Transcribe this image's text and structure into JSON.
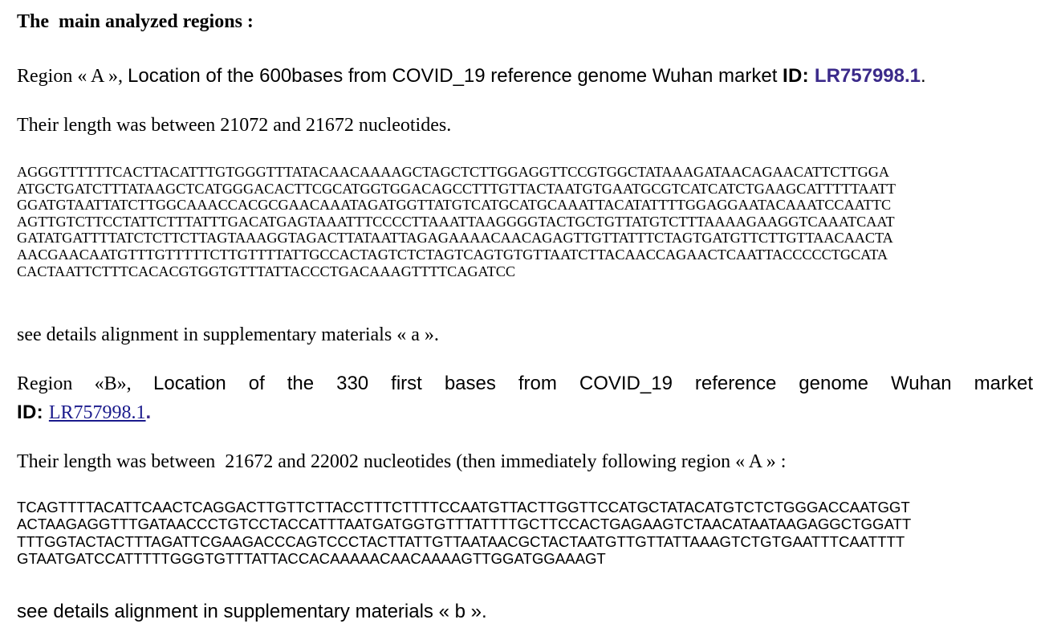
{
  "heading": "The  main analyzed regions :",
  "regionA": {
    "title_prefix": "Region « A », ",
    "title_main": "Location of the 600bases from COVID_19 reference genome Wuhan market ",
    "id_label": "ID: ",
    "id_value": "LR757998.1",
    "title_end": ".",
    "length_text": "Their length was between 21072 and 21672 nucleotides.",
    "sequence_lines": [
      "AGGGTTTTTTCACTTACATTTGTGGGTTTATACAACAAAAGCTAGCTCTTGGAGGTTCCGTGGCTATAAAGATAACAGAACATTCTTGGA",
      "ATGCTGATCTTTATAAGCTCATGGGACACTTCGCATGGTGGACAGCCTTTGTTACTAATGTGAATGCGTCATCATCTGAAGCATTTTTAATT",
      "GGATGTAATTATCTTGGCAAACCACGCGAACAAATAGATGGTTATGTCATGCATGCAAATTACATATTTTGGAGGAATACAAATCCAATTC",
      "AGTTGTCTTCCTATTCTTTATTTGACATGAGTAAATTTCCCCTTAAATTAAGGGGTACTGCTGTTATGTCTTTAAAAGAAGGTCAAATCAAT",
      "GATATGATTTTATCTCTTCTTAGTAAAGGTAGACTTATAATTAGAGAAAACAACAGAGTTGTTATTTCTAGTGATGTTCTTGTTAACAACTA",
      "AACGAACAATGTTTGTTTTTCTTGTTTTATTGCCACTAGTCTCTAGTCAGTGTGTTAATCTTACAACCAGAACTCAATTACCCCCTGCATA",
      "CACTAATTCTTTCACACGTGGTGTTTATTACCCTGACAAAGTTTTCAGATCC"
    ],
    "details_text": "see details alignment in supplementary materials « a »."
  },
  "regionB": {
    "title_prefix": "Region «B», ",
    "title_main_line1": "Location of the 330 first bases from COVID_19 reference genome Wuhan market",
    "id_label": "ID: ",
    "id_value": "LR757998.1",
    "title_end": ".",
    "length_text": "Their length was between  21672 and 22002 nucleotides (then immediately following region « A » :",
    "sequence_lines": [
      "TCAGTTTTACATTCAACTCAGGACTTGTTCTTACCTTTCTTTTCCAATGTTACTTGGTTCCATGCTATACATGTCTCTGGGACCAATGGT",
      "ACTAAGAGGTTTGATAACCCTGTCCTACCATTTAATGATGGTGTTTATTTTGCTTCCACTGAGAAGTCTAACATAATAAGAGGCTGGATT",
      "TTTGGTACTACTTTAGATTCGAAGACCCAGTCCCTACTTATTGTTAATAACGCTACTAATGTTGTTATTAAAGTCTGTGAATTTCAATTTT",
      "GTAATGATCCATTTTTGGGTGTTTATTACCACAAAAACAACAAAAGTTGGATGGAAAGT"
    ],
    "details_text": "see details alignment in supplementary materials « b »."
  },
  "colors": {
    "id_bold": "#3b2a8a",
    "id_link": "#1a1a8c"
  }
}
